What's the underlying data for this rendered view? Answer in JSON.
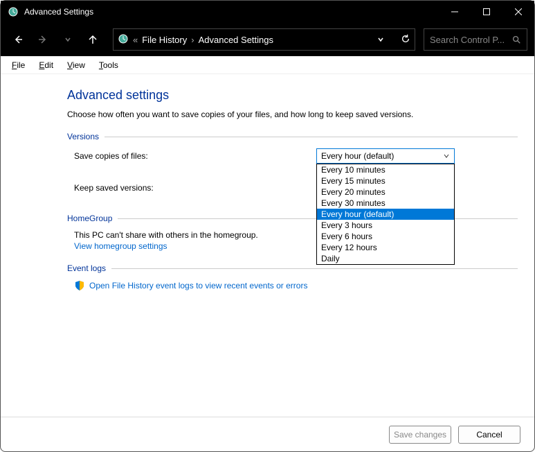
{
  "window": {
    "title": "Advanced Settings"
  },
  "breadcrumb": {
    "prefix": "«",
    "root": "File History",
    "current": "Advanced Settings"
  },
  "search": {
    "placeholder": "Search Control P..."
  },
  "menubar": {
    "file": "File",
    "edit": "Edit",
    "view": "View",
    "tools": "Tools"
  },
  "page": {
    "heading": "Advanced settings",
    "subtitle": "Choose how often you want to save copies of your files, and how long to keep saved versions."
  },
  "sections": {
    "versions": {
      "title": "Versions",
      "save_copies_label": "Save copies of files:",
      "keep_versions_label": "Keep saved versions:",
      "selected": "Every hour (default)",
      "options": [
        "Every 10 minutes",
        "Every 15 minutes",
        "Every 20 minutes",
        "Every 30 minutes",
        "Every hour (default)",
        "Every 3 hours",
        "Every 6 hours",
        "Every 12 hours",
        "Daily"
      ]
    },
    "homegroup": {
      "title": "HomeGroup",
      "text": "This PC can't share with others in the homegroup.",
      "link": "View homegroup settings"
    },
    "eventlogs": {
      "title": "Event logs",
      "link": "Open File History event logs to view recent events or errors"
    }
  },
  "footer": {
    "save": "Save changes",
    "cancel": "Cancel"
  }
}
